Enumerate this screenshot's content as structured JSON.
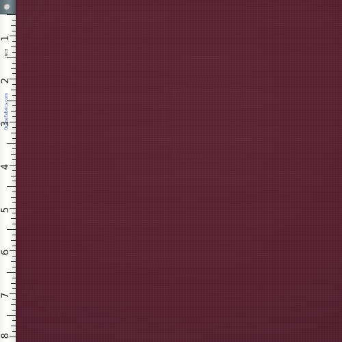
{
  "image": {
    "subject": "burgundy fabric swatch with measuring tape",
    "fabric_color": "#5b2233",
    "ruler_color": "#ffffff",
    "cap_color": "#6f7f86"
  },
  "ruler": {
    "numbers": [
      "1",
      "2",
      "3",
      "4",
      "5",
      "6",
      "7",
      "8"
    ],
    "brand": "DrapeFabrics.com",
    "mark": "INCH"
  }
}
